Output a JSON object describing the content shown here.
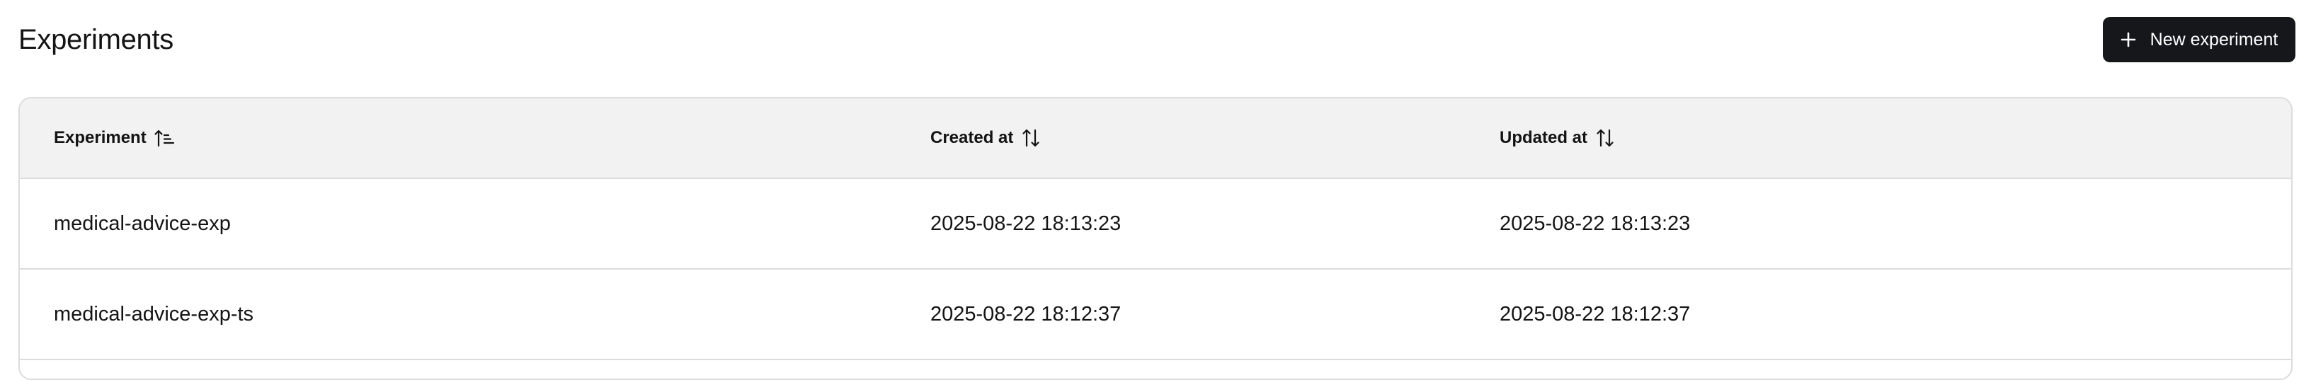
{
  "header": {
    "title": "Experiments",
    "new_button_label": "New experiment",
    "new_button_icon": "plus-icon"
  },
  "table": {
    "columns": [
      {
        "label": "Experiment",
        "sort_icon": "sort-ascending-icon"
      },
      {
        "label": "Created at",
        "sort_icon": "sort-arrows-icon"
      },
      {
        "label": "Updated at",
        "sort_icon": "sort-arrows-icon"
      }
    ],
    "rows": [
      {
        "experiment": "medical-advice-exp",
        "created_at": "2025-08-22 18:13:23",
        "updated_at": "2025-08-22 18:13:23"
      },
      {
        "experiment": "medical-advice-exp-ts",
        "created_at": "2025-08-22 18:12:37",
        "updated_at": "2025-08-22 18:12:37"
      }
    ]
  },
  "colors": {
    "button_bg": "#15171b",
    "header_bg": "#f2f2f2",
    "border": "#dcdcdc",
    "text": "#141414"
  }
}
